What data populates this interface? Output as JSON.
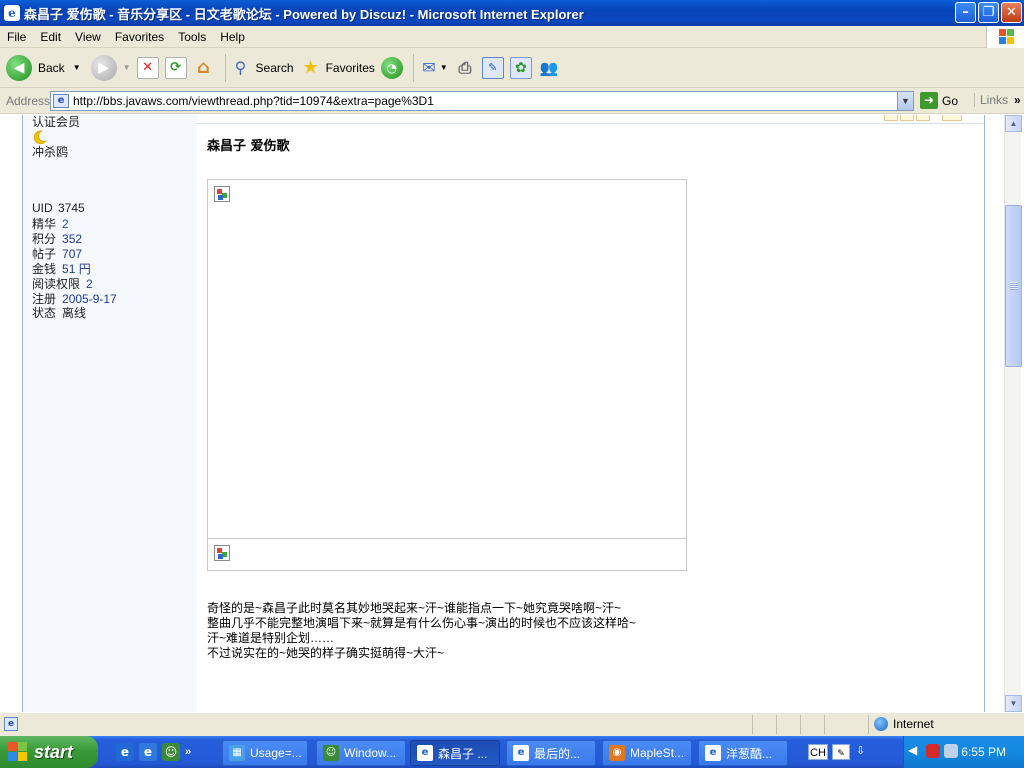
{
  "window": {
    "title": "森昌子 爱伤歌 - 音乐分享区 - 日文老歌论坛 - Powered by Discuz! - Microsoft Internet Explorer",
    "minimize": "–",
    "restore": "❐",
    "close": "✕"
  },
  "menu": [
    "File",
    "Edit",
    "View",
    "Favorites",
    "Tools",
    "Help"
  ],
  "toolbar": {
    "back_label": "Back",
    "search_label": "Search",
    "favorites_label": "Favorites"
  },
  "address": {
    "label": "Address",
    "url": "http://bbs.javaws.com/viewthread.php?tid=10974&extra=page%3D1",
    "go_label": "Go",
    "links_label": "Links"
  },
  "sidebar": {
    "group": "认证会员",
    "title": "冲杀鸥",
    "stats": [
      {
        "label": "UID",
        "value": "3745"
      },
      {
        "label": "精华",
        "value": "2"
      },
      {
        "label": "积分",
        "value": "352"
      },
      {
        "label": "帖子",
        "value": "707"
      },
      {
        "label": "金钱",
        "value": "51 円"
      },
      {
        "label": "阅读权限",
        "value": "2"
      },
      {
        "label": "注册",
        "value": "2005-9-17"
      },
      {
        "label": "状态",
        "value": "离线"
      }
    ]
  },
  "post": {
    "title": "森昌子 爱伤歌",
    "body": [
      "奇怪的是~森昌子此时莫名其妙地哭起来~汗~谁能指点一下~她究竟哭啥啊~汗~",
      "整曲几乎不能完整地演唱下来~就算是有什么伤心事~演出的时候也不应该这样哈~",
      "汗~难道是特别企划……",
      "不过说实在的~她哭的样子确实挺萌得~大汗~"
    ]
  },
  "status": {
    "zone": "Internet"
  },
  "taskbar": {
    "start_label": "start",
    "tasks": [
      "Usage=...",
      "Window...",
      "森昌子 ...",
      "最后的...",
      "MapleSt...",
      "洋葱酷..."
    ],
    "lang": "CH",
    "clock": "6:55 PM"
  },
  "colors": {
    "titlebar": "#0843b8",
    "chrome": "#ece9d8",
    "sidebar": "#f5f8fd",
    "taskbar": "#245edb",
    "start": "#3a9a3a",
    "tray": "#128ae0"
  }
}
